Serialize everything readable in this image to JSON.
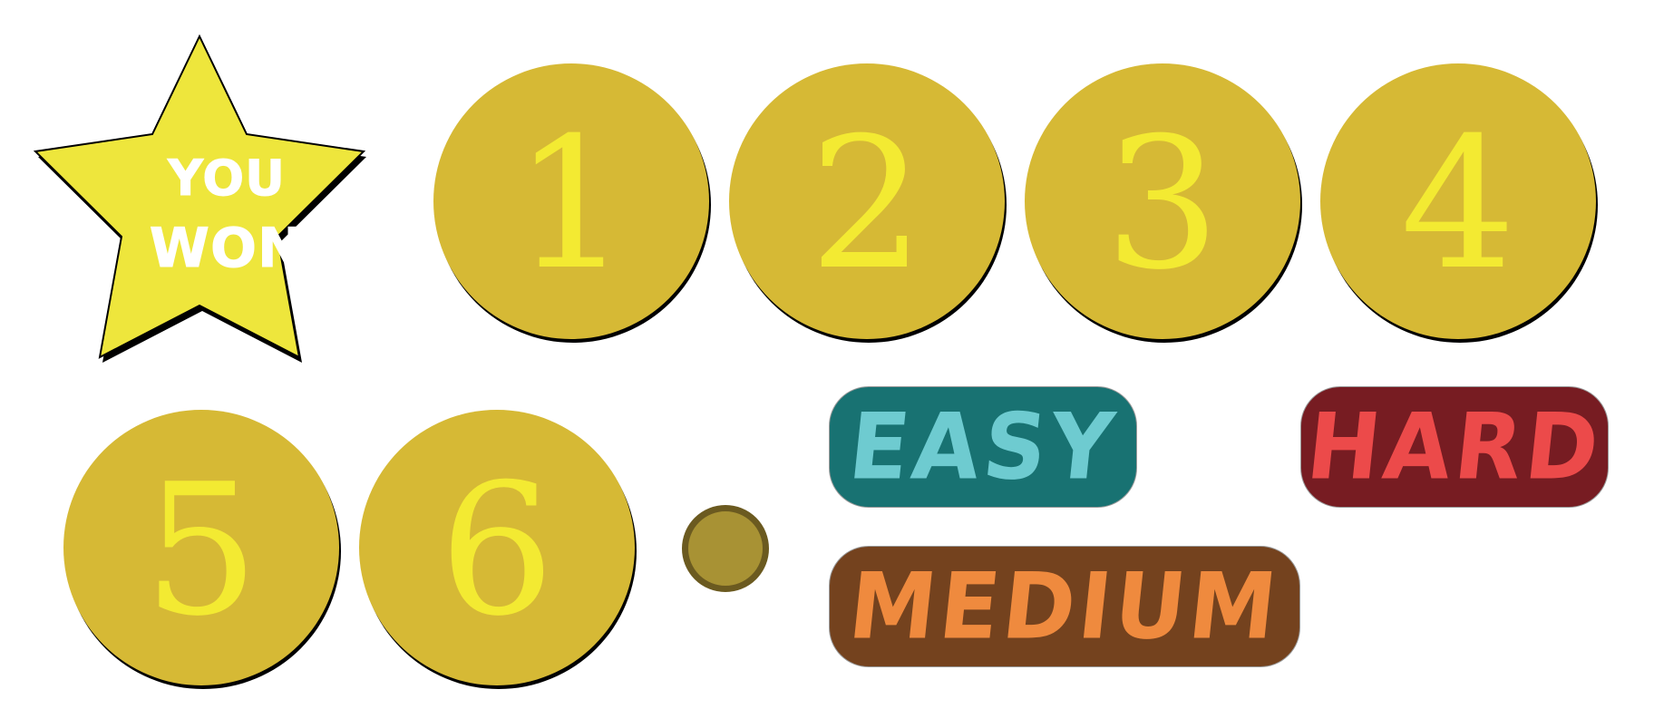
{
  "star": {
    "line1": "YOU",
    "line2": "WON",
    "fill_color": "#eee63c",
    "outline_color": "#000000"
  },
  "coins": [
    {
      "label": "1"
    },
    {
      "label": "2"
    },
    {
      "label": "3"
    },
    {
      "label": "4"
    },
    {
      "label": "5"
    },
    {
      "label": "6"
    }
  ],
  "coin_colors": {
    "fill": "#d6b935",
    "digit": "#f3ea32"
  },
  "difficulty": {
    "easy": {
      "label": "EASY",
      "bg": "#187272",
      "fg": "#6ecbd0"
    },
    "hard": {
      "label": "HARD",
      "bg": "#771c22",
      "fg": "#ec4a4a"
    },
    "medium": {
      "label": "MEDIUM",
      "bg": "#74421e",
      "fg": "#ef8a3e"
    }
  },
  "indicator": {
    "fill": "#a89234",
    "ring": "#6b5a20"
  }
}
